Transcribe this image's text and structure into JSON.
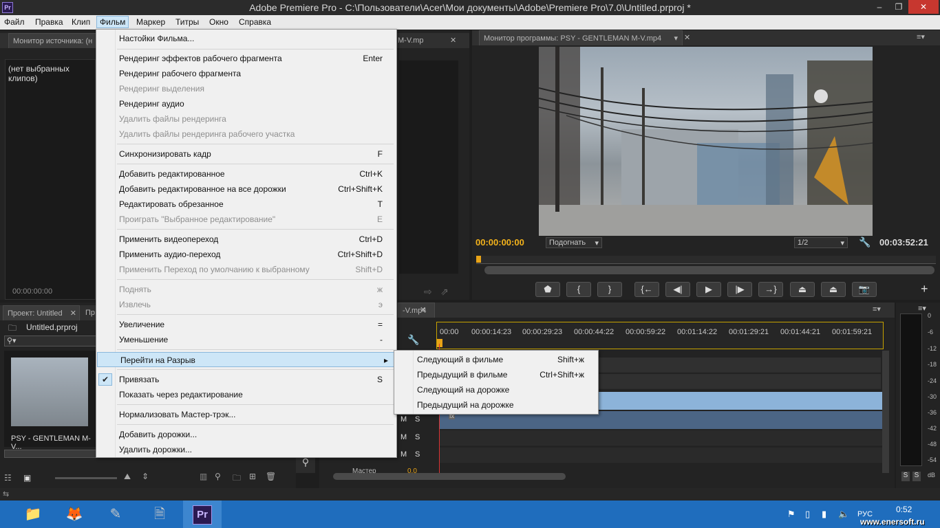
{
  "window": {
    "title": "Adobe Premiere Pro - C:\\Пользователи\\Acer\\Мои документы\\Adobe\\Premiere Pro\\7.0\\Untitled.prproj *",
    "app_icon": "Pr",
    "minimize": "–",
    "restore": "❐",
    "close": "✕"
  },
  "menubar": [
    "Файл",
    "Правка",
    "Клип",
    "Фильм",
    "Маркер",
    "Титры",
    "Окно",
    "Справка"
  ],
  "source_monitor": {
    "tab": "Монитор источника: (н",
    "tab2": "M-V.mp",
    "no_clips": "(нет выбранных клипов)",
    "timecode": "00:00:00:00"
  },
  "program_monitor": {
    "tab": "Монитор программы: PSY - GENTLEMAN M-V.mp4",
    "timecode_left": "00:00:00:00",
    "fit": "Подогнать",
    "resolution": "1/2",
    "timecode_right": "00:03:52:21"
  },
  "project": {
    "tab": "Проект: Untitled",
    "tab2": "Пр",
    "file": "Untitled.prproj",
    "search_placeholder": "",
    "clip_name": "PSY - GENTLEMAN M-V..."
  },
  "timeline": {
    "tab": "-V.mp4",
    "ticks": [
      "00:00",
      "00:00:14:23",
      "00:00:29:23",
      "00:00:44:22",
      "00:00:59:22",
      "00:01:14:22",
      "00:01:29:21",
      "00:01:44:21",
      "00:01:59:21"
    ],
    "track_m": "M",
    "track_s": "S",
    "master_label": "Мастер",
    "master_value": "0.0"
  },
  "vu_meter": {
    "labels": [
      "0",
      "-6",
      "-12",
      "-18",
      "-24",
      "-30",
      "-36",
      "-42",
      "-48",
      "-54",
      "dB"
    ],
    "solo_left": "S",
    "solo_right": "S"
  },
  "film_menu": {
    "items": [
      {
        "label": "Настойки Фильма...",
        "shortcut": "",
        "disabled": false
      },
      {
        "label": "Рендеринг эффектов рабочего фрагмента",
        "shortcut": "Enter",
        "disabled": false
      },
      {
        "label": "Рендеринг рабочего фрагмента",
        "shortcut": "",
        "disabled": false
      },
      {
        "label": "Рендеринг выделения",
        "shortcut": "",
        "disabled": true
      },
      {
        "label": "Рендеринг аудио",
        "shortcut": "",
        "disabled": false
      },
      {
        "label": "Удалить файлы рендеринга",
        "shortcut": "",
        "disabled": true
      },
      {
        "label": "Удалить файлы рендеринга рабочего участка",
        "shortcut": "",
        "disabled": true
      },
      {
        "label": "Синхронизировать кадр",
        "shortcut": "F",
        "disabled": false
      },
      {
        "label": "Добавить редактированное",
        "shortcut": "Ctrl+K",
        "disabled": false
      },
      {
        "label": "Добавить редактированное на все дорожки",
        "shortcut": "Ctrl+Shift+K",
        "disabled": false
      },
      {
        "label": "Редактировать обрезанное",
        "shortcut": "T",
        "disabled": false
      },
      {
        "label": "Проиграть \"Выбранное редактирование\"",
        "shortcut": "E",
        "disabled": true
      },
      {
        "label": "Применить видеопереход",
        "shortcut": "Ctrl+D",
        "disabled": false
      },
      {
        "label": "Применить аудио-переход",
        "shortcut": "Ctrl+Shift+D",
        "disabled": false
      },
      {
        "label": "Применить Переход по умолчанию к выбранному",
        "shortcut": "Shift+D",
        "disabled": true
      },
      {
        "label": "Поднять",
        "shortcut": "ж",
        "disabled": true
      },
      {
        "label": "Извлечь",
        "shortcut": "э",
        "disabled": true
      },
      {
        "label": "Увеличение",
        "shortcut": "=",
        "disabled": false
      },
      {
        "label": "Уменьшение",
        "shortcut": "-",
        "disabled": false
      },
      {
        "label": "Перейти на Разрыв",
        "shortcut": "",
        "disabled": false
      },
      {
        "label": "Привязать",
        "shortcut": "S",
        "disabled": false
      },
      {
        "label": "Показать через редактирование",
        "shortcut": "",
        "disabled": false
      },
      {
        "label": "Нормализовать Мастер-трэк...",
        "shortcut": "",
        "disabled": false
      },
      {
        "label": "Добавить дорожки...",
        "shortcut": "",
        "disabled": false
      },
      {
        "label": "Удалить дорожки...",
        "shortcut": "",
        "disabled": false
      }
    ]
  },
  "gap_submenu": {
    "items": [
      {
        "label": "Следующий в фильме",
        "shortcut": "Shift+ж"
      },
      {
        "label": "Предыдущий в фильме",
        "shortcut": "Ctrl+Shift+ж"
      },
      {
        "label": "Следующий на дорожке",
        "shortcut": ""
      },
      {
        "label": "Предыдущий на дорожке",
        "shortcut": ""
      }
    ]
  },
  "taskbar": {
    "lang": "РУС",
    "time": "0:52",
    "watermark": "www.enersoft.ru"
  }
}
